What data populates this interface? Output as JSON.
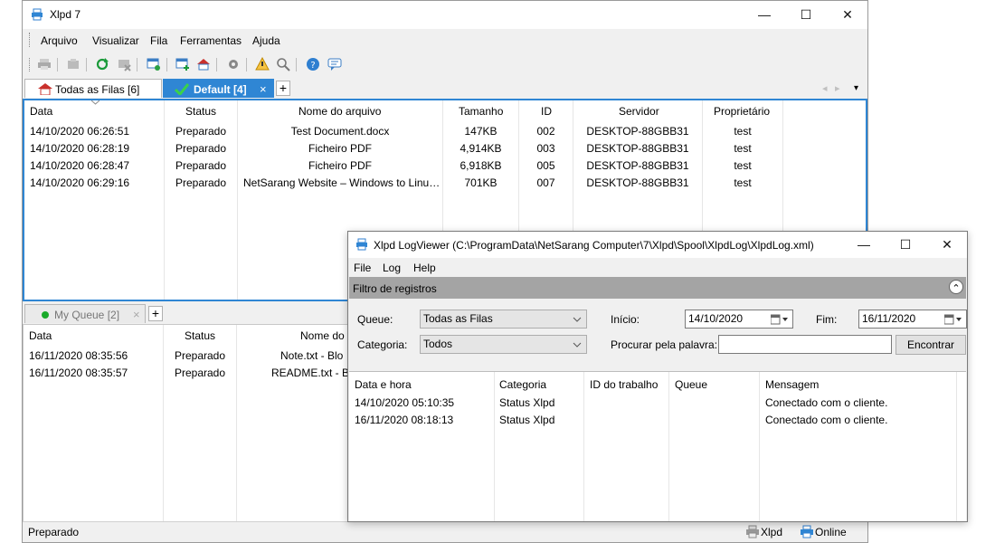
{
  "main": {
    "title": "Xlpd 7",
    "menu": [
      "Arquivo",
      "Visualizar",
      "Fila",
      "Ferramentas",
      "Ajuda"
    ],
    "window_controls": {
      "minimize": "—",
      "maximize": "☐",
      "close": "✕"
    },
    "tabs": [
      {
        "label": "Todas as Filas [6]",
        "icon": "home-icon"
      },
      {
        "label": "Default [4]",
        "icon": "check-icon",
        "close": "×"
      }
    ],
    "add_tab": "+",
    "tab_nav": {
      "prev": "◂",
      "next": "▸",
      "menu": "▾"
    },
    "columns": [
      "Data",
      "Status",
      "Nome do arquivo",
      "Tamanho",
      "ID",
      "Servidor",
      "Proprietário"
    ],
    "rows": [
      [
        "14/10/2020 06:26:51",
        "Preparado",
        "Test Document.docx",
        "147KB",
        "002",
        "DESKTOP-88GBB31",
        "test"
      ],
      [
        "14/10/2020 06:28:19",
        "Preparado",
        "Ficheiro PDF",
        "4,914KB",
        "003",
        "DESKTOP-88GBB31",
        "test"
      ],
      [
        "14/10/2020 06:28:47",
        "Preparado",
        "Ficheiro PDF",
        "6,918KB",
        "005",
        "DESKTOP-88GBB31",
        "test"
      ],
      [
        "14/10/2020 06:29:16",
        "Preparado",
        "NetSarang Website – Windows to Linu…",
        "701KB",
        "007",
        "DESKTOP-88GBB31",
        "test"
      ]
    ],
    "queue_tab": {
      "label": "My Queue [2]",
      "close": "×"
    },
    "queue_add_tab": "+",
    "queue_columns": [
      "Data",
      "Status",
      "Nome do"
    ],
    "queue_rows": [
      [
        "16/11/2020 08:35:56",
        "Preparado",
        "Note.txt - Blo"
      ],
      [
        "16/11/2020 08:35:57",
        "Preparado",
        "README.txt - Bl"
      ]
    ],
    "status": "Preparado",
    "status_right": [
      "Xlpd",
      "Online"
    ],
    "colors": {
      "accent": "#2f86d4",
      "online_dot": "#1aaa2a"
    }
  },
  "log": {
    "title": "Xlpd LogViewer (C:\\ProgramData\\NetSarang Computer\\7\\Xlpd\\Spool\\XlpdLog\\XlpdLog.xml)",
    "window_controls": {
      "minimize": "—",
      "maximize": "☐",
      "close": "✕"
    },
    "menu": [
      "File",
      "Log",
      "Help"
    ],
    "filter_header": "Filtro de registros",
    "filter_toggle": "⌃",
    "queue_label": "Queue:",
    "queue_value": "Todas as Filas",
    "category_label": "Categoria:",
    "category_value": "Todos",
    "start_label": "Início:",
    "start_value": "14/10/2020",
    "end_label": "Fim:",
    "end_value": "16/11/2020",
    "search_label": "Procurar pela palavra:",
    "search_value": "",
    "search_button": "Encontrar",
    "columns": [
      "Data e hora",
      "Categoria",
      "ID do trabalho",
      "Queue",
      "Mensagem"
    ],
    "rows": [
      [
        "14/10/2020 05:10:35",
        "Status Xlpd",
        "",
        "",
        "Conectado com o cliente."
      ],
      [
        "16/11/2020 08:18:13",
        "Status Xlpd",
        "",
        "",
        "Conectado com o cliente."
      ]
    ]
  }
}
